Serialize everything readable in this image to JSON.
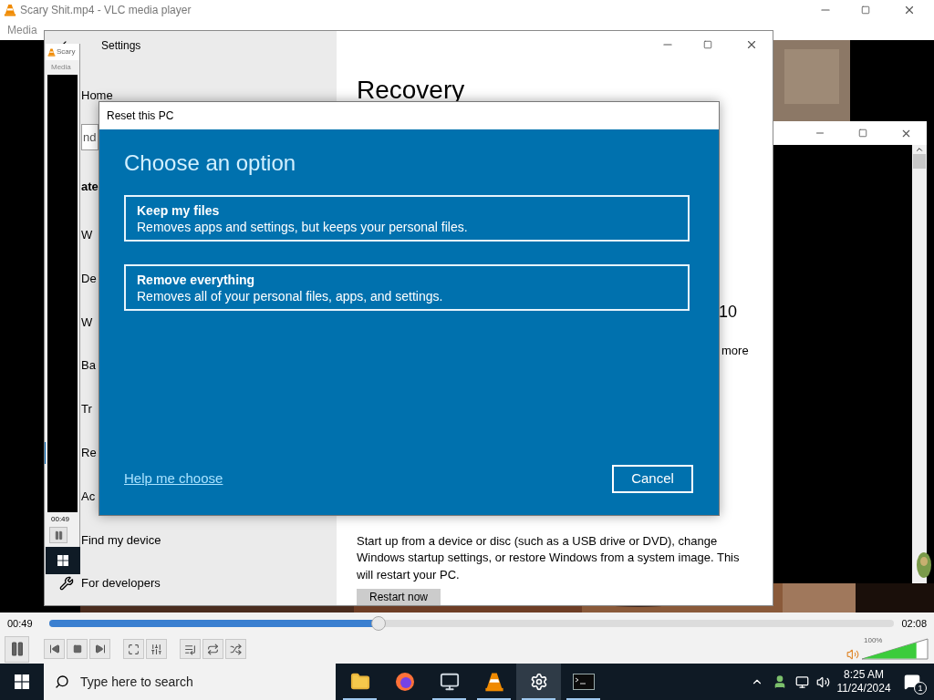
{
  "vlc_main": {
    "title": "Scary Shit.mp4 - VLC media player",
    "menu": [
      "Media"
    ],
    "time_elapsed": "00:49",
    "time_total": "02:08",
    "progress": {
      "level": 0.39
    },
    "volume": {
      "reading": "100%",
      "level": 0.82
    }
  },
  "vlc_mini": {
    "title": "Scary",
    "menu": [
      "Media"
    ],
    "time": "00:49"
  },
  "settings": {
    "title": "Settings",
    "sidebar": {
      "items": [
        {
          "label": "Home",
          "kind": "link",
          "selected": false
        },
        {
          "label": "nd",
          "kind": "search",
          "selected": false
        },
        {
          "label": "ate",
          "kind": "header",
          "selected": false
        },
        {
          "label": "W",
          "kind": "link",
          "selected": false
        },
        {
          "label": "De",
          "kind": "link",
          "selected": false
        },
        {
          "label": "W",
          "kind": "link",
          "selected": false
        },
        {
          "label": "Ba",
          "kind": "link",
          "selected": false
        },
        {
          "label": "Tr",
          "kind": "link",
          "selected": false
        },
        {
          "label": "Re",
          "kind": "link",
          "selected": true
        },
        {
          "label": "Ac",
          "kind": "link",
          "selected": false
        },
        {
          "label": "Find my device",
          "kind": "link",
          "selected": false
        },
        {
          "label": "For developers",
          "kind": "developer",
          "selected": false
        }
      ]
    },
    "heading": "Recovery",
    "fragment_1": "10",
    "fragment_2": "more",
    "paragraph": "Start up from a device or disc (such as a USB drive or DVD), change Windows startup settings, or restore Windows from a system image. This will restart your PC.",
    "button": "Restart now"
  },
  "dialog": {
    "title": "Reset this PC",
    "heading": "Choose an option",
    "options": [
      {
        "title": "Keep my files",
        "description": "Removes apps and settings, but keeps your personal files."
      },
      {
        "title": "Remove everything",
        "description": "Removes all of your personal files, apps, and settings."
      }
    ],
    "link": "Help me choose",
    "cancel": "Cancel"
  },
  "taskbar": {
    "search_placeholder": "Type here to search",
    "apps": [
      {
        "kind": "explorer",
        "running": true,
        "selected": false
      },
      {
        "kind": "firefox",
        "running": false,
        "selected": false
      },
      {
        "kind": "computer",
        "running": true,
        "selected": false
      },
      {
        "kind": "vlc",
        "running": true,
        "selected": false
      },
      {
        "kind": "settings",
        "running": true,
        "selected": true
      },
      {
        "kind": "terminal",
        "running": true,
        "selected": false
      }
    ],
    "time": "8:25 AM",
    "date": "11/24/2024",
    "notifications": "1"
  }
}
